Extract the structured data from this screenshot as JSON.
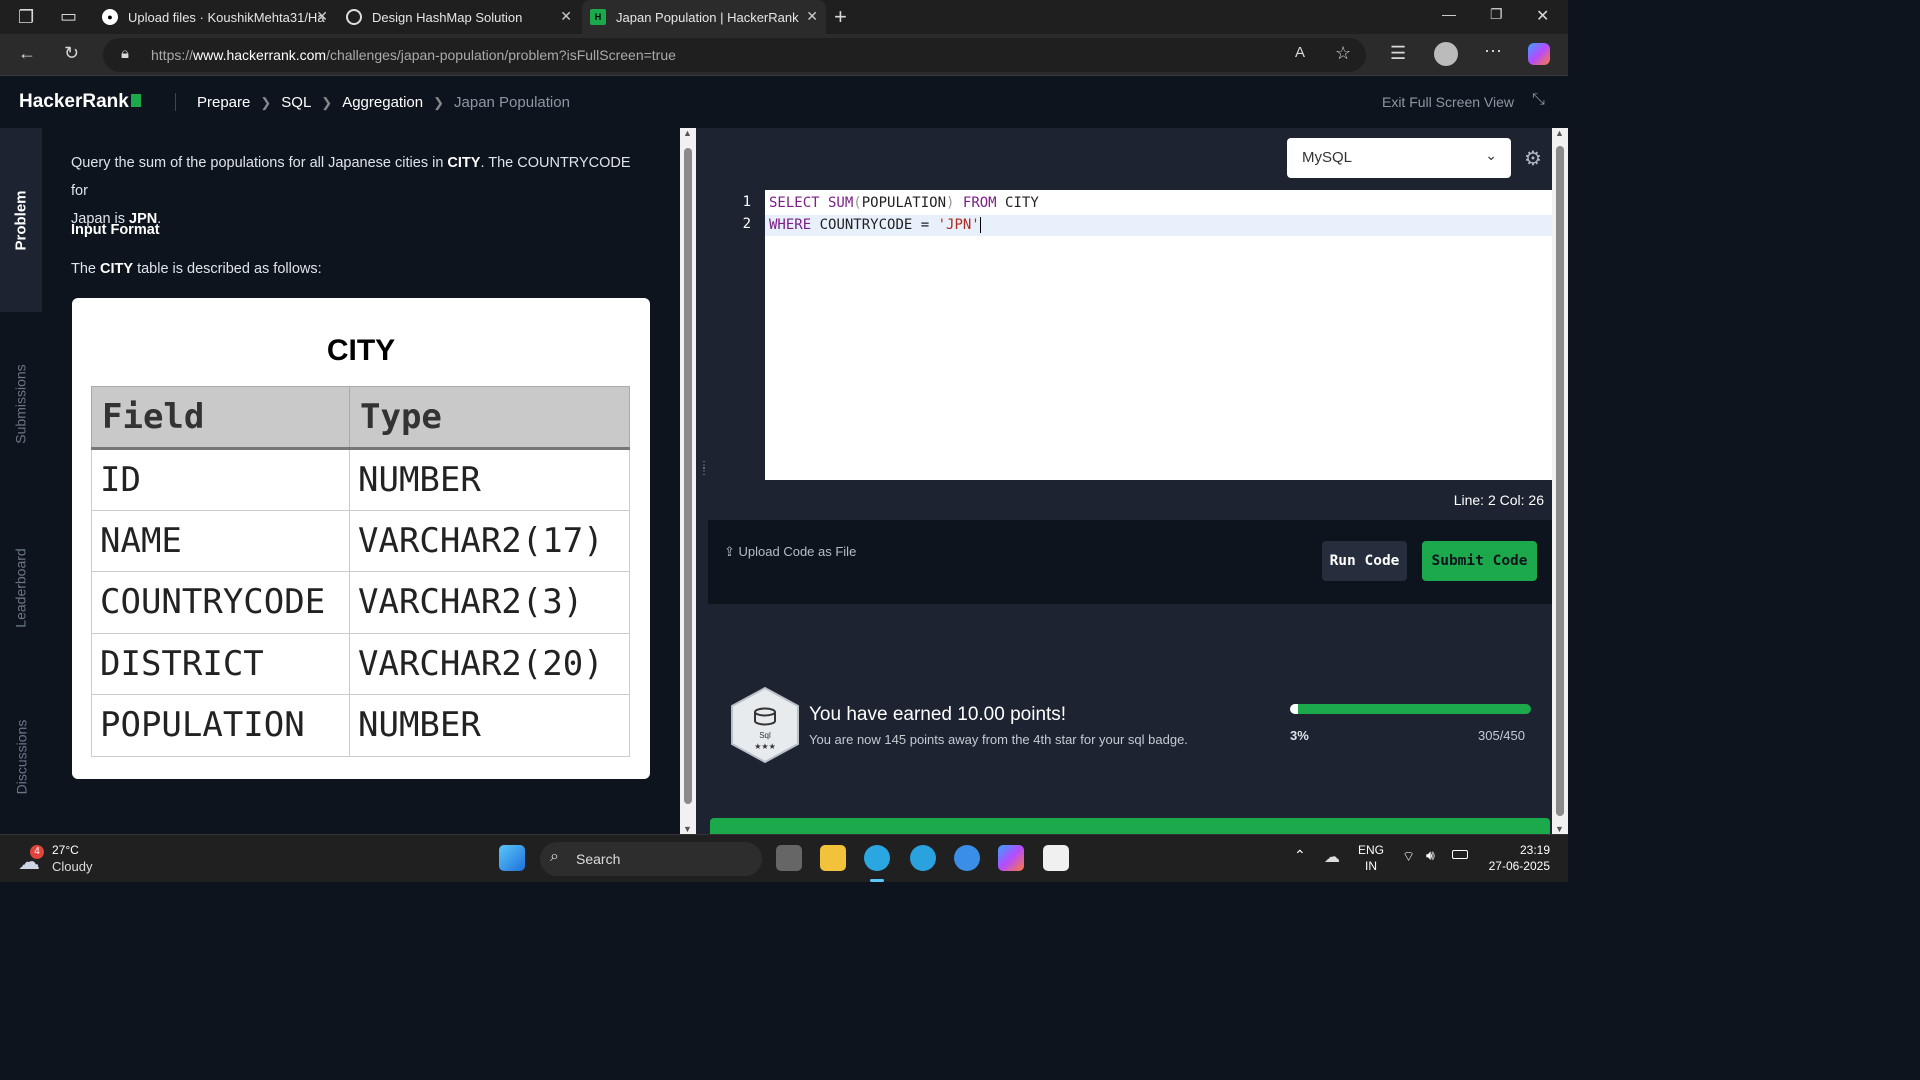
{
  "browser": {
    "tabs": [
      {
        "title": "Upload files · KoushikMehta31/Ha"
      },
      {
        "title": "Design HashMap Solution"
      },
      {
        "title": "Japan Population | HackerRank"
      }
    ],
    "url_prefix": "https://",
    "url_domain": "www.hackerrank.com",
    "url_path": "/challenges/japan-population/problem?isFullScreen=true"
  },
  "header": {
    "logo": "HackerRank",
    "breadcrumbs": [
      "Prepare",
      "SQL",
      "Aggregation",
      "Japan Population"
    ],
    "exit_fullscreen": "Exit Full Screen View"
  },
  "rail": {
    "tabs": [
      "Problem",
      "Submissions",
      "Leaderboard",
      "Discussions"
    ]
  },
  "problem": {
    "intro_1": "Query the sum of the populations for all Japanese cities in ",
    "intro_city": "CITY",
    "intro_2": ". The COUNTRYCODE for",
    "intro_3": "Japan is ",
    "intro_jpn": "JPN",
    "intro_4": ".",
    "input_format": "Input Format",
    "desc_1": "The ",
    "desc_city": "CITY",
    "desc_2": " table is described as follows:",
    "table_title": "CITY",
    "table_headers": [
      "Field",
      "Type"
    ],
    "table_rows": [
      [
        "ID",
        "NUMBER"
      ],
      [
        "NAME",
        "VARCHAR2(17)"
      ],
      [
        "COUNTRYCODE",
        "VARCHAR2(3)"
      ],
      [
        "DISTRICT",
        "VARCHAR2(20)"
      ],
      [
        "POPULATION",
        "NUMBER"
      ]
    ]
  },
  "editor": {
    "language": "MySQL",
    "line_numbers": [
      "1",
      "2"
    ],
    "line1": {
      "k1": "SELECT",
      "f1": " SUM",
      "p1": "(",
      "a1": "POPULATION",
      "p2": ")",
      "k2": " FROM",
      "t1": " CITY"
    },
    "line2": {
      "k1": "WHERE",
      "a1": " COUNTRYCODE = ",
      "s1": "'JPN'"
    },
    "cursor_pos": "Line: 2 Col: 26",
    "upload_label": "Upload Code as File",
    "run_label": "Run Code",
    "submit_label": "Submit Code"
  },
  "result": {
    "badge_label": "Sql",
    "badge_stars": "★★★",
    "earned": "You have earned 10.00 points!",
    "away": "You are now 145 points away from the 4th star for your sql badge.",
    "progress_fraction": 0.03,
    "progress_pct": "3%",
    "points": "305/450"
  },
  "taskbar": {
    "weather_badge": "4",
    "temp": "27°C",
    "condition": "Cloudy",
    "search_label": "Search",
    "lang_1": "ENG",
    "lang_2": "IN",
    "time": "23:19",
    "date": "27-06-2025"
  },
  "colors": {
    "accent_green": "#1ba94c",
    "dark_bg": "#0e141e",
    "panel_bg": "#1d2331"
  }
}
